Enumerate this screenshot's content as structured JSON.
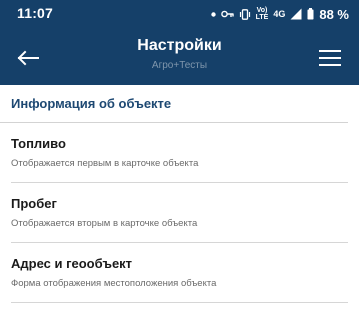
{
  "status_bar": {
    "time": "11:07",
    "network_top": "Vo)",
    "network_bottom": "LTE",
    "network_4g": "4G",
    "battery": "88 %"
  },
  "header": {
    "title": "Настройки",
    "subtitle": "Агро+Тесты",
    "background_color": "#154069"
  },
  "section": {
    "title": "Информация об объекте"
  },
  "items": [
    {
      "title": "Топливо",
      "description": "Отображается первым в карточке объекта"
    },
    {
      "title": "Пробег",
      "description": "Отображается вторым в карточке объекта"
    },
    {
      "title": "Адрес и геообъект",
      "description": "Форма отображения местоположения объекта"
    }
  ]
}
